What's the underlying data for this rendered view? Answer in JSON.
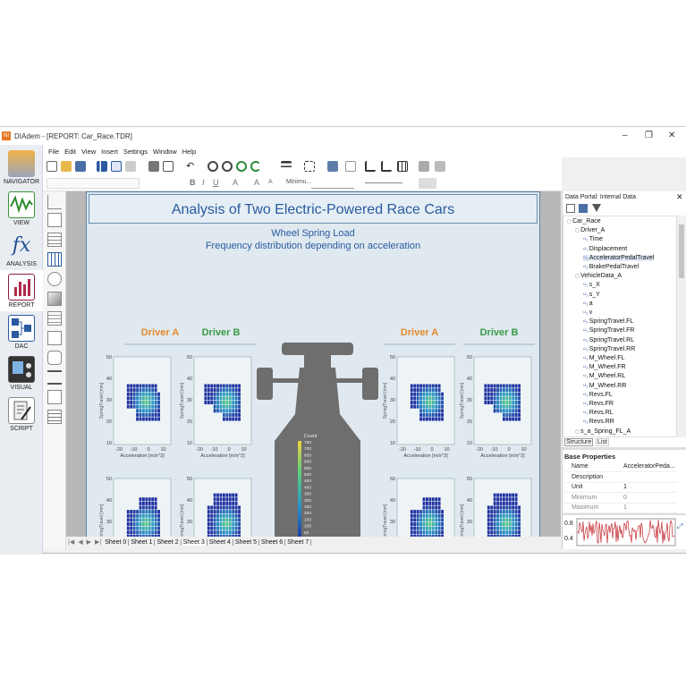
{
  "window": {
    "app_title": "DIAdem - [REPORT:  Car_Race.TDR]",
    "controls": [
      "–",
      "❐",
      "✕"
    ]
  },
  "menu": [
    "File",
    "Edit",
    "View",
    "Insert",
    "Settings",
    "Window",
    "Help"
  ],
  "nav": [
    {
      "label": "NAVIGATOR",
      "icon": "navigator-icon"
    },
    {
      "label": "VIEW",
      "icon": "view-icon"
    },
    {
      "label": "ANALYSIS",
      "icon": "analysis-icon"
    },
    {
      "label": "REPORT",
      "icon": "report-icon"
    },
    {
      "label": "DAC",
      "icon": "dac-icon"
    },
    {
      "label": "VISUAL",
      "icon": "visual-icon"
    },
    {
      "label": "SCRIPT",
      "icon": "script-icon"
    }
  ],
  "toolbar2": {
    "font_value": "Minimu..."
  },
  "report": {
    "title": "Analysis of Two Electric-Powered Race Cars",
    "subtitle1": "Wheel Spring Load",
    "subtitle2": "Frequency distribution depending on acceleration",
    "driverA": "Driver A",
    "driverB": "Driver B",
    "colors": {
      "driverA": "#e58a2c",
      "driverB": "#3a9a48",
      "heat_low": "#1e2fa0",
      "heat_high": "#5fd07a"
    },
    "count_label": "Count",
    "count_ticks": [
      "750",
      "700",
      "650",
      "600",
      "550",
      "500",
      "450",
      "400",
      "350",
      "300",
      "250",
      "200",
      "150",
      "100",
      "50",
      "0"
    ],
    "xlabel": "Acceleration [m/s^2]",
    "ylabel": "SpringTravel [mm]",
    "xticks": [
      "-20",
      "-10",
      "0",
      "10"
    ],
    "yticks": [
      "50",
      "40",
      "30",
      "20",
      "10"
    ]
  },
  "chart_data": {
    "type": "heatmap",
    "xlabel": "Acceleration [m/s^2]",
    "ylabel": "SpringTravel [mm]",
    "xlim": [
      -25,
      15
    ],
    "ylim": [
      10,
      50
    ],
    "colorbar": {
      "label": "Count",
      "range": [
        0,
        750
      ]
    },
    "panels": [
      {
        "name": "Driver A",
        "position": "front-left",
        "shape": "A"
      },
      {
        "name": "Driver B",
        "position": "front-left",
        "shape": "B"
      },
      {
        "name": "Driver A",
        "position": "front-right",
        "shape": "A"
      },
      {
        "name": "Driver B",
        "position": "front-right",
        "shape": "B"
      },
      {
        "name": "Driver A",
        "position": "rear-left",
        "shape": "C"
      },
      {
        "name": "Driver B",
        "position": "rear-left",
        "shape": "D"
      },
      {
        "name": "Driver A",
        "position": "rear-right",
        "shape": "C"
      },
      {
        "name": "Driver B",
        "position": "rear-right",
        "shape": "D"
      }
    ]
  },
  "sheets": [
    "Sheet 0",
    "Sheet 1",
    "Sheet 2",
    "Sheet 3",
    "Sheet 4",
    "Sheet 5",
    "Sheet 6",
    "Sheet 7"
  ],
  "data_portal": {
    "title": "Data Portal: Internal Data",
    "tree": [
      {
        "label": "Car_Race",
        "level": 0
      },
      {
        "label": "Driver_A",
        "level": 1
      },
      {
        "label": "Time",
        "level": 2
      },
      {
        "label": "Displacement",
        "level": 2
      },
      {
        "label": "AcceleratorPedalTravel",
        "level": 2,
        "selected": true
      },
      {
        "label": "BrakePedalTravel",
        "level": 2
      },
      {
        "label": "VehicleData_A",
        "level": 1
      },
      {
        "label": "s_X",
        "level": 2
      },
      {
        "label": "s_Y",
        "level": 2
      },
      {
        "label": "a",
        "level": 2
      },
      {
        "label": "v",
        "level": 2
      },
      {
        "label": "SpringTravel.FL",
        "level": 2
      },
      {
        "label": "SpringTravel.FR",
        "level": 2
      },
      {
        "label": "SpringTravel.RL",
        "level": 2
      },
      {
        "label": "SpringTravel.RR",
        "level": 2
      },
      {
        "label": "M_Wheel.FL",
        "level": 2
      },
      {
        "label": "M_Wheel.FR",
        "level": 2
      },
      {
        "label": "M_Wheel.RL",
        "level": 2
      },
      {
        "label": "M_Wheel.RR",
        "level": 2
      },
      {
        "label": "Revs.FL",
        "level": 2
      },
      {
        "label": "Revs.FR",
        "level": 2
      },
      {
        "label": "Revs.RL",
        "level": 2
      },
      {
        "label": "Revs.RR",
        "level": 2
      },
      {
        "label": "s_a_Spring_FL_A",
        "level": 1
      }
    ],
    "tabs": [
      "Structure",
      "List"
    ],
    "props_title": "Base Properties",
    "props": [
      {
        "name": "Name",
        "value": "AcceleratorPeda..."
      },
      {
        "name": "Description",
        "value": ""
      },
      {
        "name": "Unit",
        "value": "1"
      },
      {
        "name": "Minimum",
        "value": "0"
      },
      {
        "name": "Maximum",
        "value": "1"
      }
    ],
    "preview_ticks": [
      "0.8",
      "0.4"
    ]
  }
}
